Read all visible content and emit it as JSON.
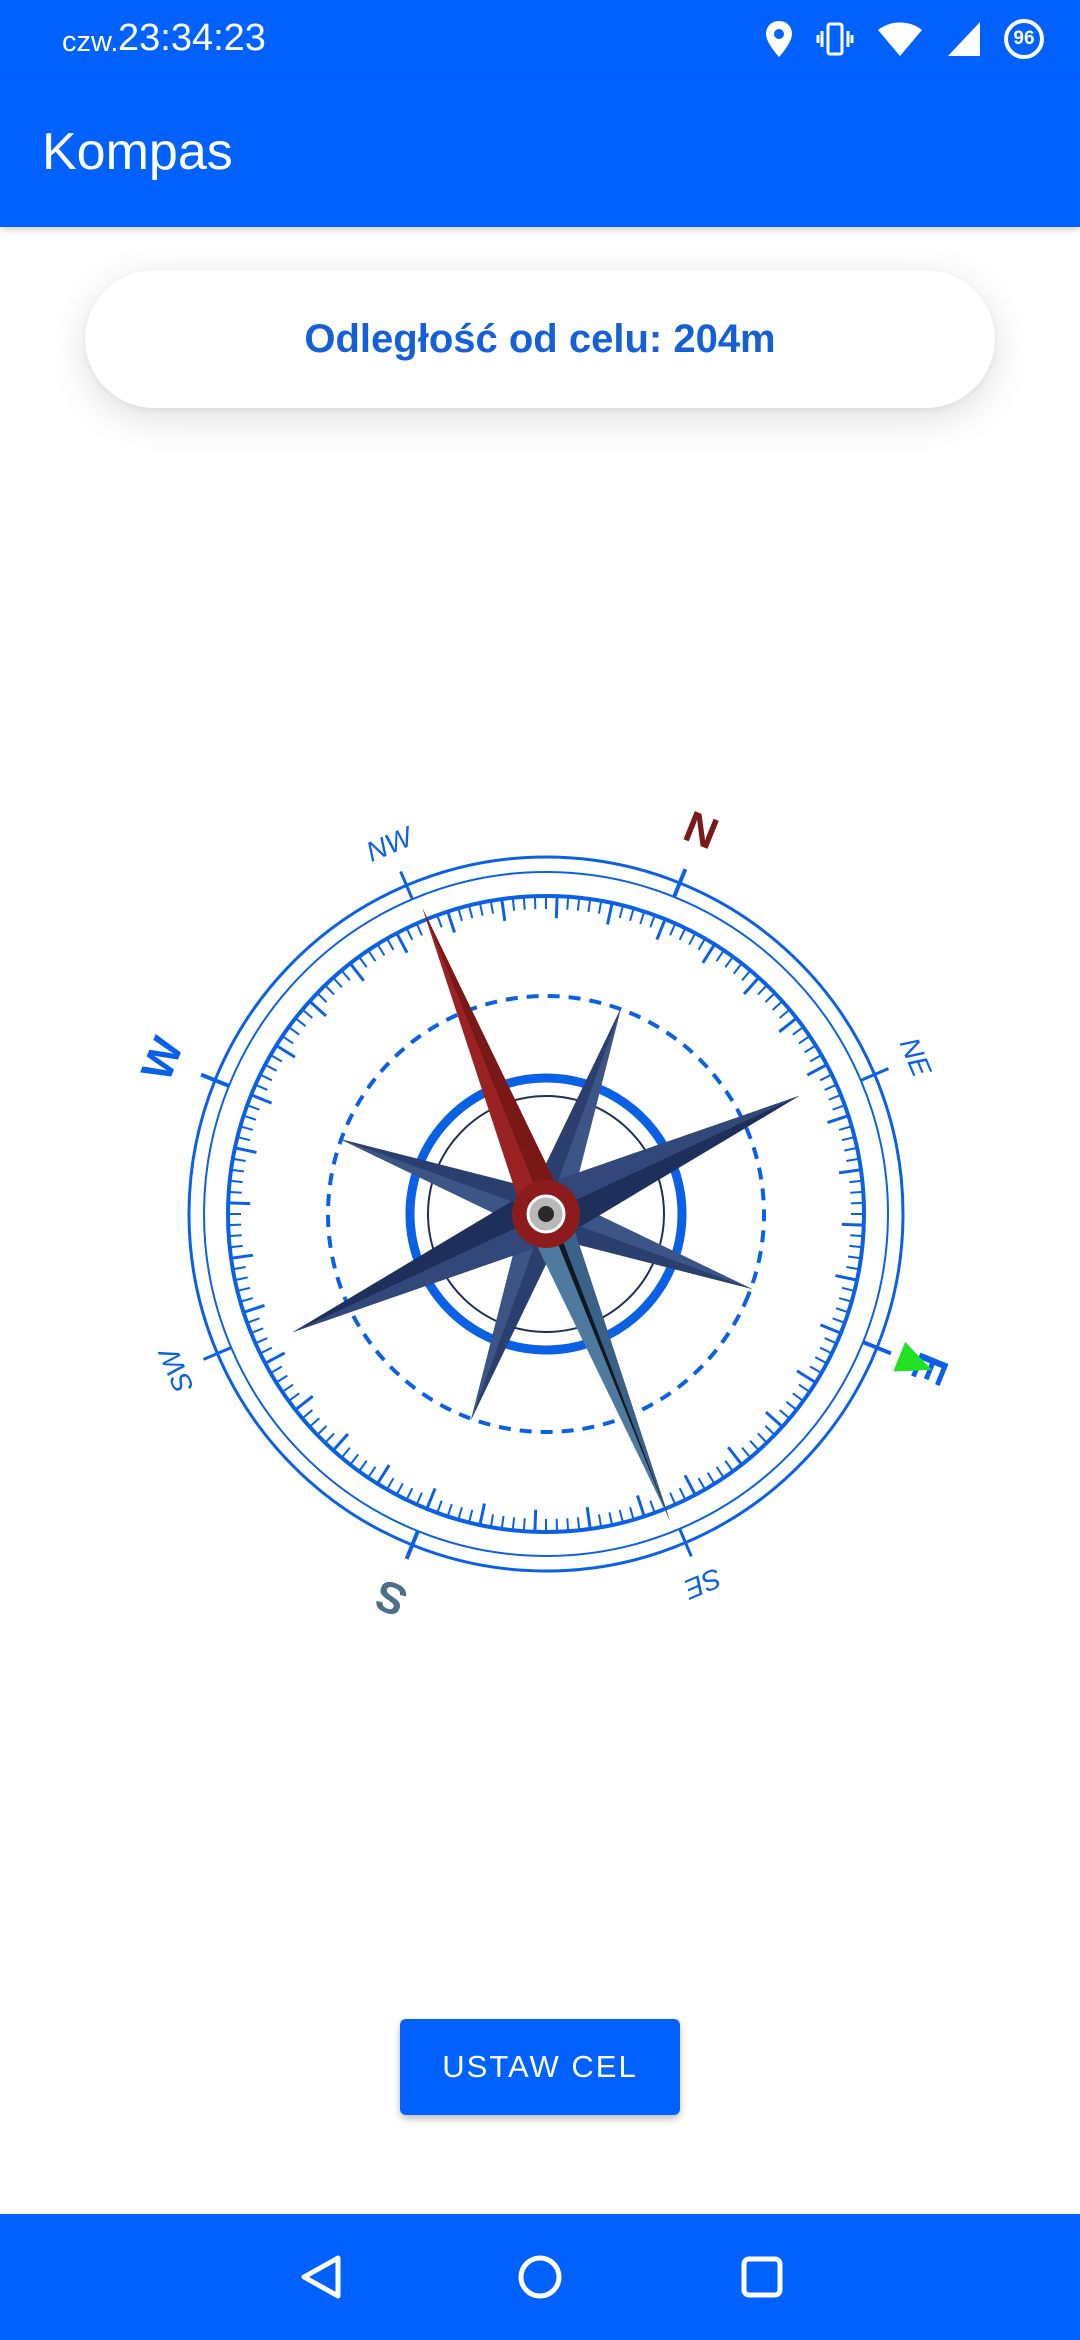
{
  "status_bar": {
    "day": "czw.",
    "time": "23:34:23",
    "battery_level": "96",
    "icons": [
      "location-icon",
      "vibrate-icon",
      "wifi-icon",
      "signal-icon",
      "battery-icon"
    ]
  },
  "app_bar": {
    "title": "Kompas"
  },
  "distance": {
    "text": "Odległość od celu: 204m"
  },
  "compass": {
    "cardinal_labels": [
      "N",
      "E",
      "S",
      "W"
    ],
    "intercardinal_labels": [
      "NE",
      "SE",
      "SW",
      "NW"
    ],
    "dial_rotation_deg": 22,
    "needle_heading_deg": -22,
    "target_bearing_deg": 112,
    "colors": {
      "ring": "#0b61e5",
      "north_label": "#7a1a1a",
      "south_label": "#4f6f86",
      "needle_north": "#9b2222",
      "needle_south": "#4e7aa0",
      "star": "#1d2f5a",
      "target_marker": "#22e022"
    }
  },
  "actions": {
    "set_target_label": "USTAW CEL"
  },
  "nav_bar": {
    "buttons": [
      "back-icon",
      "home-icon",
      "recents-icon"
    ]
  }
}
